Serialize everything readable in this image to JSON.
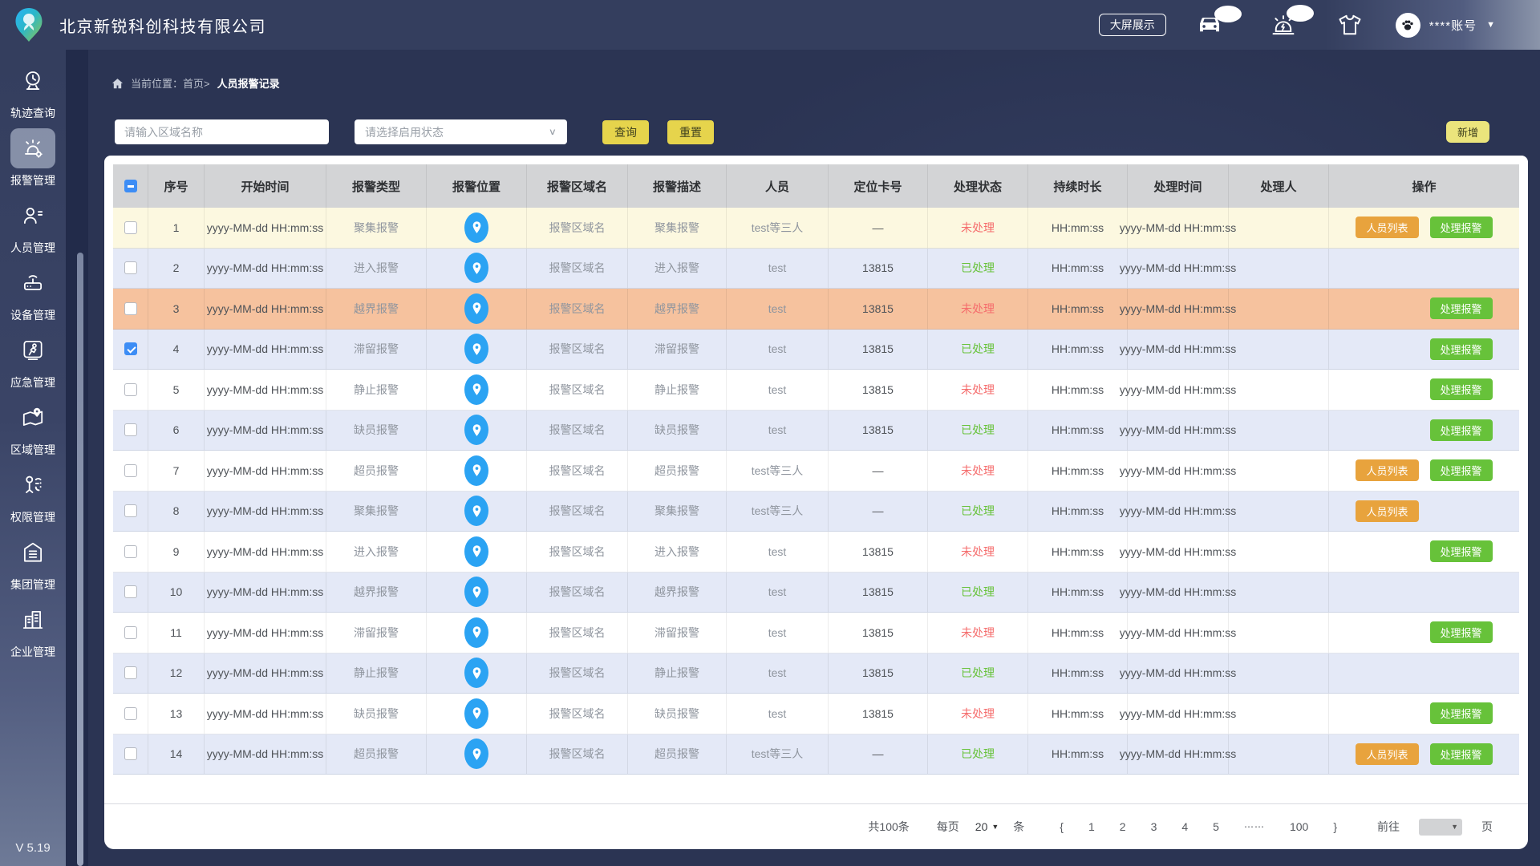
{
  "header": {
    "company": "北京新锐科创科技有限公司",
    "big_screen": "大屏展示",
    "account": "****账号"
  },
  "sidebar": {
    "items": [
      {
        "label": "轨迹查询",
        "icon": "track-pin-icon",
        "active": false
      },
      {
        "label": "报警管理",
        "icon": "alarm-siren-icon",
        "active": true
      },
      {
        "label": "人员管理",
        "icon": "person-list-icon",
        "active": false
      },
      {
        "label": "设备管理",
        "icon": "device-icon",
        "active": false
      },
      {
        "label": "应急管理",
        "icon": "emergency-runner-icon",
        "active": false
      },
      {
        "label": "区域管理",
        "icon": "map-pin-icon",
        "active": false
      },
      {
        "label": "权限管理",
        "icon": "permission-icon",
        "active": false
      },
      {
        "label": "集团管理",
        "icon": "group-home-icon",
        "active": false
      },
      {
        "label": "企业管理",
        "icon": "enterprise-buildings-icon",
        "active": false
      }
    ],
    "version": "V 5.19"
  },
  "breadcrumb": {
    "prefix": "当前位置：",
    "path": "首页>",
    "current": "人员报警记录"
  },
  "filters": {
    "area_placeholder": "请输入区域名称",
    "status_placeholder": "请选择启用状态",
    "search": "查询",
    "reset": "重置",
    "add": "新增"
  },
  "table": {
    "columns": [
      "",
      "序号",
      "开始时间",
      "报警类型",
      "报警位置",
      "报警区域名",
      "报警描述",
      "人员",
      "定位卡号",
      "处理状态",
      "持续时长",
      "处理时间",
      "处理人",
      "操作"
    ],
    "action_labels": {
      "person_list": "人员列表",
      "handle": "处理报警"
    },
    "rows": [
      {
        "num": "1",
        "start": "yyyy-MM-dd HH:mm:ss",
        "type": "聚集报警",
        "area": "报警区域名",
        "desc": "聚集报警",
        "person": "test等三人",
        "card": "—",
        "status": "未处理",
        "state": "pending",
        "duration": "HH:mm:ss",
        "handled_at": "yyyy-MM-dd HH:mm:ss",
        "handler": "",
        "bg": "yellow",
        "checked": false,
        "actions": {
          "person_list": true,
          "handle": true
        }
      },
      {
        "num": "2",
        "start": "yyyy-MM-dd HH:mm:ss",
        "type": "进入报警",
        "area": "报警区域名",
        "desc": "进入报警",
        "person": "test",
        "card": "13815",
        "status": "已处理",
        "state": "done",
        "duration": "HH:mm:ss",
        "handled_at": "yyyy-MM-dd HH:mm:ss",
        "handler": "",
        "bg": "lav",
        "checked": false,
        "actions": {
          "person_list": false,
          "handle": false
        }
      },
      {
        "num": "3",
        "start": "yyyy-MM-dd HH:mm:ss",
        "type": "越界报警",
        "area": "报警区域名",
        "desc": "越界报警",
        "person": "test",
        "card": "13815",
        "status": "未处理",
        "state": "pending",
        "duration": "HH:mm:ss",
        "handled_at": "yyyy-MM-dd HH:mm:ss",
        "handler": "",
        "bg": "orange",
        "checked": false,
        "actions": {
          "person_list": false,
          "handle": true
        }
      },
      {
        "num": "4",
        "start": "yyyy-MM-dd HH:mm:ss",
        "type": "滞留报警",
        "area": "报警区域名",
        "desc": "滞留报警",
        "person": "test",
        "card": "13815",
        "status": "已处理",
        "state": "done",
        "duration": "HH:mm:ss",
        "handled_at": "yyyy-MM-dd HH:mm:ss",
        "handler": "",
        "bg": "lav",
        "checked": true,
        "actions": {
          "person_list": false,
          "handle": true
        }
      },
      {
        "num": "5",
        "start": "yyyy-MM-dd HH:mm:ss",
        "type": "静止报警",
        "area": "报警区域名",
        "desc": "静止报警",
        "person": "test",
        "card": "13815",
        "status": "未处理",
        "state": "pending",
        "duration": "HH:mm:ss",
        "handled_at": "yyyy-MM-dd HH:mm:ss",
        "handler": "",
        "bg": "white",
        "checked": false,
        "actions": {
          "person_list": false,
          "handle": true
        }
      },
      {
        "num": "6",
        "start": "yyyy-MM-dd HH:mm:ss",
        "type": "缺员报警",
        "area": "报警区域名",
        "desc": "缺员报警",
        "person": "test",
        "card": "13815",
        "status": "已处理",
        "state": "done",
        "duration": "HH:mm:ss",
        "handled_at": "yyyy-MM-dd HH:mm:ss",
        "handler": "",
        "bg": "lav",
        "checked": false,
        "actions": {
          "person_list": false,
          "handle": true
        }
      },
      {
        "num": "7",
        "start": "yyyy-MM-dd HH:mm:ss",
        "type": "超员报警",
        "area": "报警区域名",
        "desc": "超员报警",
        "person": "test等三人",
        "card": "—",
        "status": "未处理",
        "state": "pending",
        "duration": "HH:mm:ss",
        "handled_at": "yyyy-MM-dd HH:mm:ss",
        "handler": "",
        "bg": "white",
        "checked": false,
        "actions": {
          "person_list": true,
          "handle": true
        }
      },
      {
        "num": "8",
        "start": "yyyy-MM-dd HH:mm:ss",
        "type": "聚集报警",
        "area": "报警区域名",
        "desc": "聚集报警",
        "person": "test等三人",
        "card": "—",
        "status": "已处理",
        "state": "done",
        "duration": "HH:mm:ss",
        "handled_at": "yyyy-MM-dd HH:mm:ss",
        "handler": "",
        "bg": "lav",
        "checked": false,
        "actions": {
          "person_list": true,
          "handle": false
        }
      },
      {
        "num": "9",
        "start": "yyyy-MM-dd HH:mm:ss",
        "type": "进入报警",
        "area": "报警区域名",
        "desc": "进入报警",
        "person": "test",
        "card": "13815",
        "status": "未处理",
        "state": "pending",
        "duration": "HH:mm:ss",
        "handled_at": "yyyy-MM-dd HH:mm:ss",
        "handler": "",
        "bg": "white",
        "checked": false,
        "actions": {
          "person_list": false,
          "handle": true
        }
      },
      {
        "num": "10",
        "start": "yyyy-MM-dd HH:mm:ss",
        "type": "越界报警",
        "area": "报警区域名",
        "desc": "越界报警",
        "person": "test",
        "card": "13815",
        "status": "已处理",
        "state": "done",
        "duration": "HH:mm:ss",
        "handled_at": "yyyy-MM-dd HH:mm:ss",
        "handler": "",
        "bg": "lav",
        "checked": false,
        "actions": {
          "person_list": false,
          "handle": false
        }
      },
      {
        "num": "11",
        "start": "yyyy-MM-dd HH:mm:ss",
        "type": "滞留报警",
        "area": "报警区域名",
        "desc": "滞留报警",
        "person": "test",
        "card": "13815",
        "status": "未处理",
        "state": "pending",
        "duration": "HH:mm:ss",
        "handled_at": "yyyy-MM-dd HH:mm:ss",
        "handler": "",
        "bg": "white",
        "checked": false,
        "actions": {
          "person_list": false,
          "handle": true
        }
      },
      {
        "num": "12",
        "start": "yyyy-MM-dd HH:mm:ss",
        "type": "静止报警",
        "area": "报警区域名",
        "desc": "静止报警",
        "person": "test",
        "card": "13815",
        "status": "已处理",
        "state": "done",
        "duration": "HH:mm:ss",
        "handled_at": "yyyy-MM-dd HH:mm:ss",
        "handler": "",
        "bg": "lav",
        "checked": false,
        "actions": {
          "person_list": false,
          "handle": false
        }
      },
      {
        "num": "13",
        "start": "yyyy-MM-dd HH:mm:ss",
        "type": "缺员报警",
        "area": "报警区域名",
        "desc": "缺员报警",
        "person": "test",
        "card": "13815",
        "status": "未处理",
        "state": "pending",
        "duration": "HH:mm:ss",
        "handled_at": "yyyy-MM-dd HH:mm:ss",
        "handler": "",
        "bg": "white",
        "checked": false,
        "actions": {
          "person_list": false,
          "handle": true
        }
      },
      {
        "num": "14",
        "start": "yyyy-MM-dd HH:mm:ss",
        "type": "超员报警",
        "area": "报警区域名",
        "desc": "超员报警",
        "person": "test等三人",
        "card": "—",
        "status": "已处理",
        "state": "done",
        "duration": "HH:mm:ss",
        "handled_at": "yyyy-MM-dd HH:mm:ss",
        "handler": "",
        "bg": "lav",
        "checked": false,
        "actions": {
          "person_list": true,
          "handle": true
        }
      }
    ]
  },
  "pagination": {
    "total": "共100条",
    "per_page_label": "每页",
    "per_page_value": "20",
    "unit": "条",
    "prev": "{",
    "pages": [
      "1",
      "2",
      "3",
      "4",
      "5"
    ],
    "ellipsis": "⋯⋯",
    "last_page": "100",
    "next": "}",
    "goto_label": "前往",
    "goto_unit": "页"
  },
  "colors": {
    "header_navy": "#343e5e",
    "main_bg": "#2b3453",
    "accent_yellow": "#e6d44c",
    "add_yellow": "#ebe47c",
    "button_orange": "#e8a33d",
    "button_green": "#67c23a",
    "status_red": "#f56c6c",
    "status_green": "#67c23a",
    "pin_blue": "#2ba3f3",
    "row_yellow": "#fcf8e0",
    "row_lavender": "#e4e9f7",
    "row_orange": "#f6c29e",
    "checkbox_blue": "#3d8df5"
  }
}
